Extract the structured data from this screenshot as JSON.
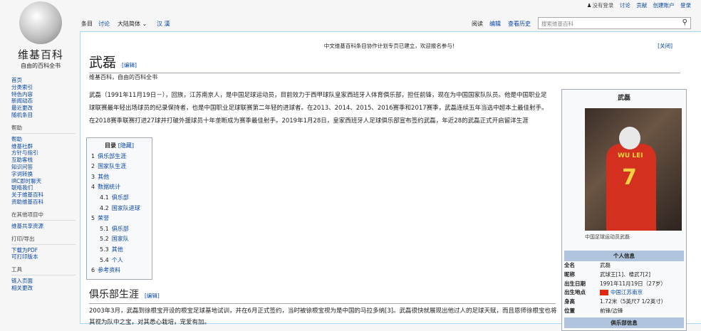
{
  "logo": {
    "title": "维基百科",
    "tagline": "自由的百科全书"
  },
  "personal": [
    "没有登录",
    "讨论",
    "贡献",
    "创建账户",
    "登录"
  ],
  "tabs": {
    "article": "条目",
    "talk": "讨论",
    "variant": "大陆简体",
    "lang": "汉 漢",
    "read": "阅读",
    "edit": "编辑",
    "history": "查看历史"
  },
  "search": {
    "placeholder": "搜索维基百科"
  },
  "sidebar": {
    "nav": [
      "首页",
      "分类索引",
      "特色内容",
      "新闻动态",
      "最近更改",
      "随机条目"
    ],
    "help_title": "帮助",
    "help": [
      "帮助",
      "维基社群",
      "方针与指引",
      "互助客栈",
      "知识问答",
      "字词转换",
      "IRC即时聊天",
      "联络我们",
      "关于维基百科",
      "资助维基百科"
    ],
    "other_title": "在其他项目中",
    "other": [
      "维基共享资源"
    ],
    "print_title": "打印/导出",
    "print": [
      "下载为PDF",
      "可打印版本"
    ],
    "tools_title": "工具",
    "tools": [
      "链入页面",
      "相关更改"
    ]
  },
  "notice": {
    "text": "中文维基百科条目协作计划专页已建立，欢迎报名参与！",
    "close": "[关闭]"
  },
  "article": {
    "title": "武磊",
    "edit": "[编辑]",
    "subtitle": "维基百科，自由的百科全书",
    "lead": "武磊（1991年11月19日－），回族，江苏南京人，是中国足球运动员，目前效力于西甲球队皇家西班牙人体育俱乐部，担任前锋，现在为中国国家队队员。他是中国职业足球联赛最年轻出场球员的纪录保持者，也是中国职业足球联赛第二年轻的进球者。在2013、2014、2015、2016赛季和2017赛季，武磊连续五年当选中超本土最佳射手。在2018赛季联赛打进27球并打破外援球员十年垄断成为赛季最佳射手。2019年1月28日，皇家西班牙人足球俱乐部宣布签约武磊，年近28的武磊正式开启留洋生涯",
    "toc_title": "目录",
    "toc_hide": "[隐藏]",
    "toc": [
      {
        "n": "1",
        "t": "俱乐部生涯"
      },
      {
        "n": "2",
        "t": "国家队生涯"
      },
      {
        "n": "3",
        "t": "其他"
      },
      {
        "n": "4",
        "t": "数据统计"
      },
      {
        "n": "4.1",
        "t": "俱乐部"
      },
      {
        "n": "4.2",
        "t": "国家队进球"
      },
      {
        "n": "5",
        "t": "荣誉"
      },
      {
        "n": "5.1",
        "t": "俱乐部"
      },
      {
        "n": "5.2",
        "t": "国家队"
      },
      {
        "n": "5.3",
        "t": "其他"
      },
      {
        "n": "5.4",
        "t": "个人"
      },
      {
        "n": "6",
        "t": "参考资料"
      }
    ],
    "section": "俱乐部生涯",
    "section_edit": "[编辑]",
    "club": "2003年3月，武磊到徐根宝开设的根宝足球基地试训，并在6月正式签约，当时被徐根宝视为是中国的马拉多纳[3]。武磊很快就展现出他过人的足球天赋，而且恩师徐根宝也将其视为队中之宝，对其悉心栽培，宠爱有加。"
  },
  "infobox": {
    "title": "武磊",
    "caption": "中国足球运动员武磊",
    "personal": "个人信息",
    "rows": [
      {
        "k": "全名",
        "v": "武磊"
      },
      {
        "k": "昵称",
        "v": "武球王[1]、楼武7[2]"
      },
      {
        "k": "出生日期",
        "v": "1991年11月19日（27岁）"
      },
      {
        "k": "出生地点",
        "v": "中国江苏南京"
      },
      {
        "k": "身高",
        "v": "1.72米（5英尺7 1/2英寸）"
      },
      {
        "k": "位置",
        "v": "前锋/边锋"
      }
    ],
    "club_info": "俱乐部信息",
    "shirt_name": "WU LEI",
    "shirt_number": "7"
  }
}
